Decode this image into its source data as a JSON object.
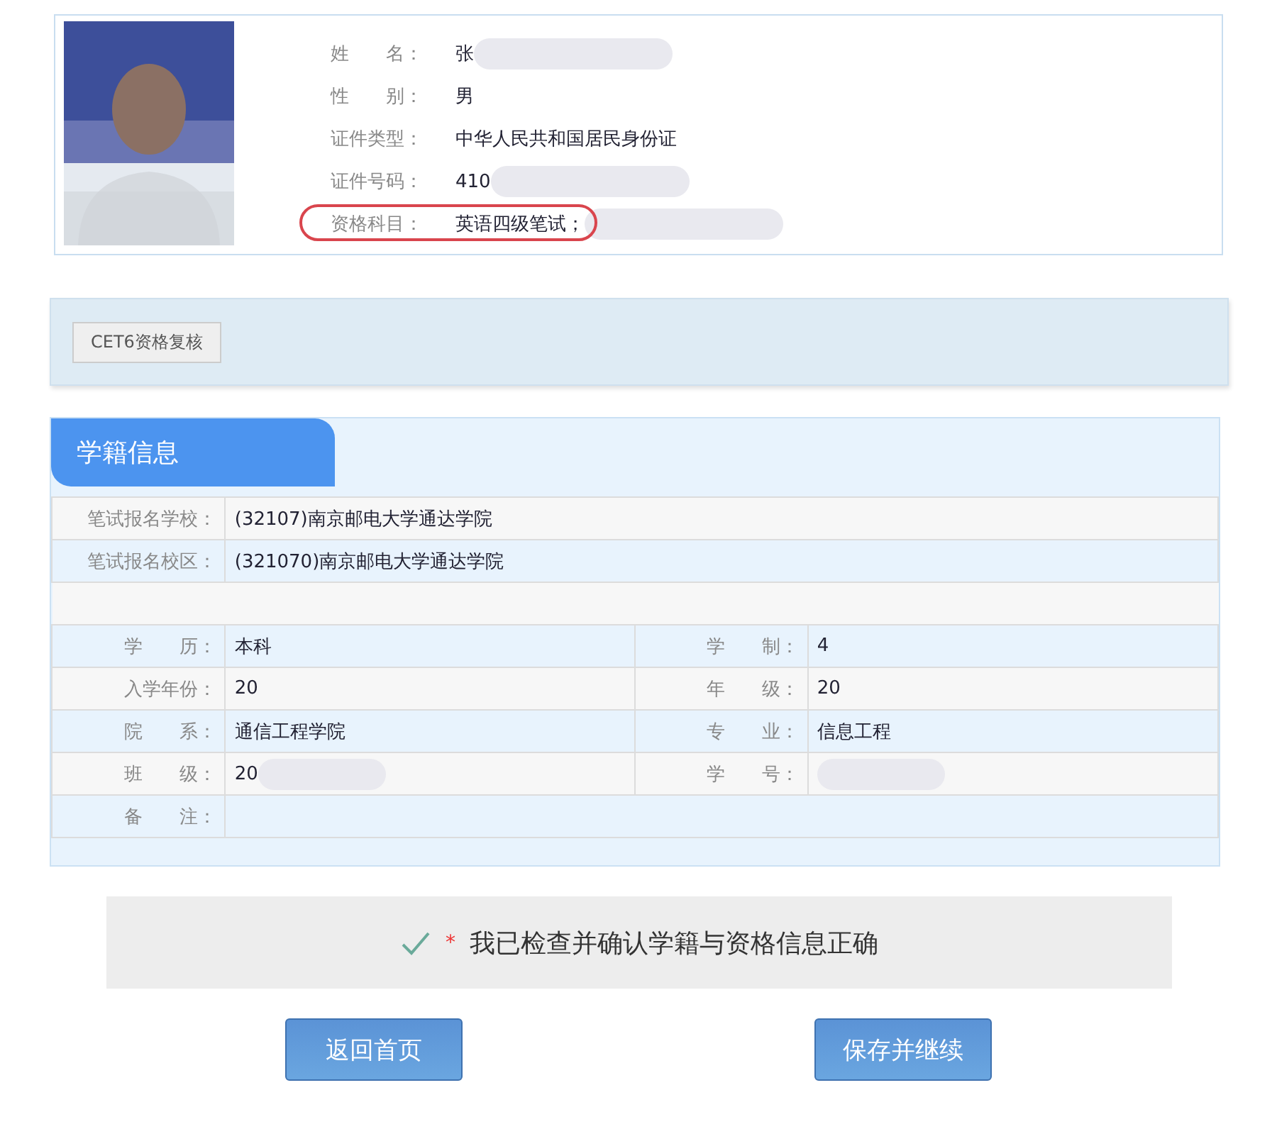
{
  "profile": {
    "fields": [
      {
        "label": "姓　　名：",
        "value": "张",
        "redacted": true
      },
      {
        "label": "性　　别：",
        "value": "男"
      },
      {
        "label": "证件类型：",
        "value": "中华人民共和国居民身份证"
      },
      {
        "label": "证件号码：",
        "value": "410",
        "redacted": true
      },
      {
        "label": "资格科目：",
        "value": "英语四级笔试；",
        "redacted": true,
        "highlighted": true
      }
    ]
  },
  "review_button": "CET6资格复核",
  "student_info": {
    "title": "学籍信息",
    "rows": [
      {
        "kind": "pair",
        "cells": [
          {
            "label": "笔试报名学校：",
            "value": "(32107)南京邮电大学通达学院"
          }
        ]
      },
      {
        "kind": "pair",
        "cells": [
          {
            "label": "笔试报名校区：",
            "value": "(321070)南京邮电大学通达学院"
          }
        ]
      },
      {
        "kind": "blank"
      },
      {
        "kind": "pair",
        "cells": [
          {
            "label": "学　　历：",
            "value": "本科"
          },
          {
            "label": "学　　制：",
            "value": "4"
          }
        ]
      },
      {
        "kind": "pair",
        "cells": [
          {
            "label": "入学年份：",
            "value": "20"
          },
          {
            "label": "年　　级：",
            "value": "20"
          }
        ]
      },
      {
        "kind": "pair",
        "cells": [
          {
            "label": "院　　系：",
            "value": "通信工程学院"
          },
          {
            "label": "专　　业：",
            "value": "信息工程"
          }
        ]
      },
      {
        "kind": "pair",
        "cells": [
          {
            "label": "班　　级：",
            "value": "20",
            "redacted": true
          },
          {
            "label": "学　　号：",
            "redacted": true
          }
        ]
      },
      {
        "kind": "pair",
        "cells": [
          {
            "label": "备　　注："
          }
        ]
      }
    ]
  },
  "confirm": {
    "checked": true,
    "required": "*",
    "text": "我已检查并确认学籍与资格信息正确"
  },
  "buttons": [
    "返回首页",
    "保存并继续"
  ]
}
